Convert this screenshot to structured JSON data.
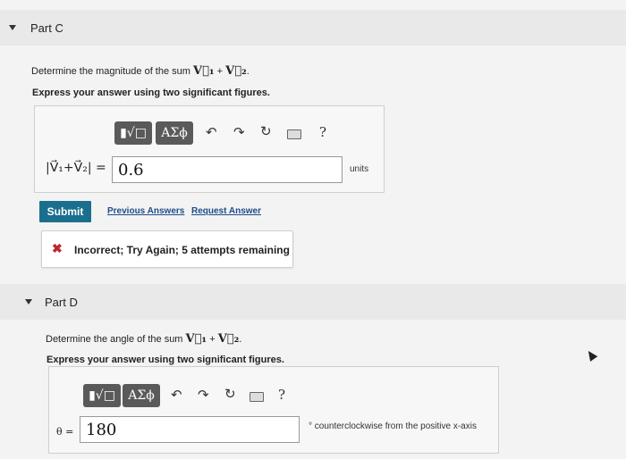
{
  "part_c": {
    "title": "Part C",
    "question_prefix": "Determine the magnitude of the sum",
    "question_v1": "V⃗₁",
    "plus": "+",
    "question_v2": "V⃗₂",
    "question_end": ".",
    "instruction": "Express your answer using two significant figures.",
    "toolbar": {
      "template_label": "▮√□",
      "greek_label": "ΑΣϕ",
      "undo_icon": "undo-icon",
      "redo_icon": "redo-icon",
      "reset_icon": "reset-icon",
      "keyboard_icon": "keyboard-icon",
      "help_label": "?"
    },
    "answer_label": "|V⃗₁+V⃗₂| =",
    "answer_value": "0.6",
    "units": "units",
    "submit_label": "Submit",
    "previous_answers": "Previous Answers",
    "request_answer": "Request Answer",
    "feedback": "Incorrect; Try Again; 5 attempts remaining"
  },
  "part_d": {
    "title": "Part D",
    "question_prefix": "Determine the angle of the sum",
    "question_v1": "V⃗₁",
    "plus": "+",
    "question_v2": "V⃗₂",
    "question_end": ".",
    "instruction": "Express your answer using two significant figures.",
    "toolbar": {
      "template_label": "▮√□",
      "greek_label": "ΑΣϕ",
      "help_label": "?"
    },
    "answer_label": "θ =",
    "answer_value": "180",
    "units": "° counterclockwise from the positive x-axis"
  },
  "colors": {
    "submit": "#1a6f8f",
    "link": "#1d4c8a",
    "error": "#c0262d",
    "toolbar": "#5a5a5a"
  }
}
